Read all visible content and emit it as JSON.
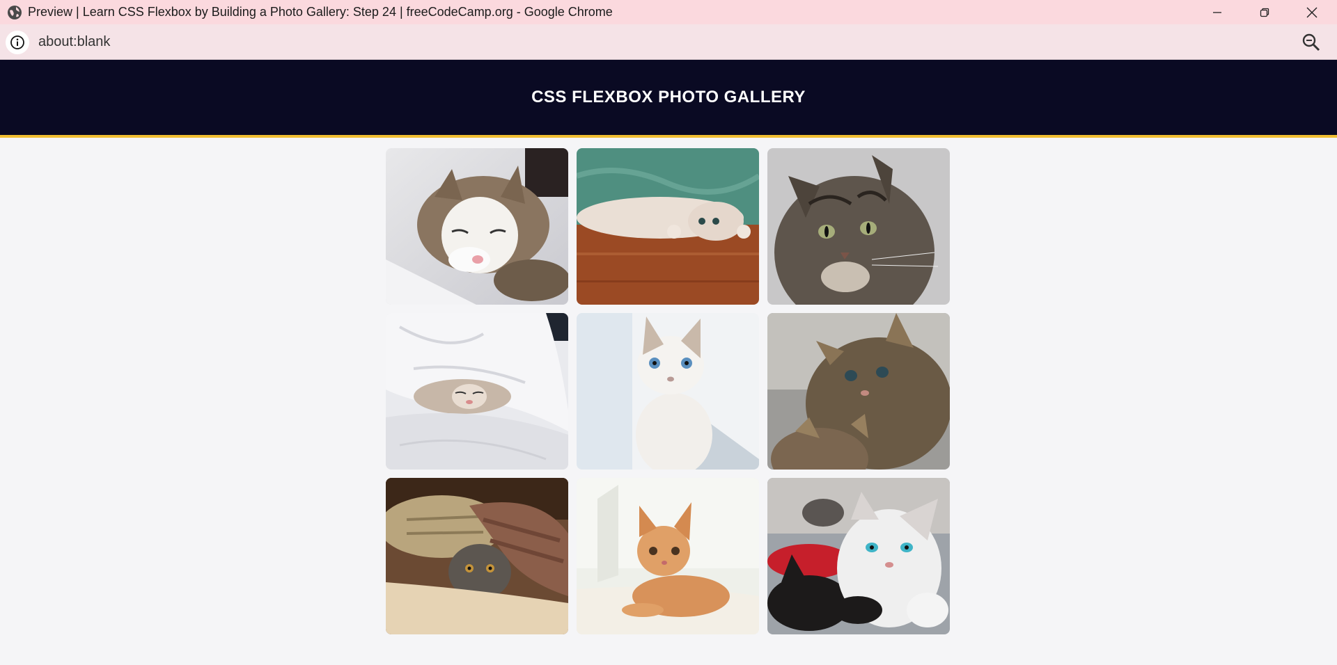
{
  "browser": {
    "window_title": "Preview | Learn CSS Flexbox by Building a Photo Gallery: Step 24 | freeCodeCamp.org - Google Chrome",
    "url": "about:blank",
    "icons": {
      "page_icon": "globe-icon",
      "minimize": "minimize-icon",
      "restore": "restore-icon",
      "close": "close-icon",
      "site_info": "info-icon",
      "zoom": "zoom-out-icon"
    }
  },
  "page": {
    "title": "CSS FLEXBOX PHOTO GALLERY",
    "header_bg": "#0a0a23",
    "header_border": "#f1be32",
    "body_bg": "#f5f5f7"
  },
  "gallery": {
    "photos": [
      {
        "name": "cat-photo-1",
        "subject": "sleeping tabby-and-white cat on white blanket"
      },
      {
        "name": "cat-photo-2",
        "subject": "cat lying upside down on wooden floor"
      },
      {
        "name": "cat-photo-3",
        "subject": "gray tabby cat close-up"
      },
      {
        "name": "cat-photo-4",
        "subject": "cat sleeping under white duvet"
      },
      {
        "name": "cat-photo-5",
        "subject": "white kitten with blue eyes"
      },
      {
        "name": "cat-photo-6",
        "subject": "two tabby kittens"
      },
      {
        "name": "cat-photo-7",
        "subject": "cat hiding under brown blanket"
      },
      {
        "name": "cat-photo-8",
        "subject": "orange kitten lying down"
      },
      {
        "name": "cat-photo-9",
        "subject": "white and black kittens on red blanket"
      }
    ]
  }
}
